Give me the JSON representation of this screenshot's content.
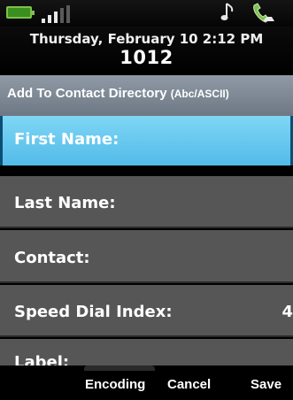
{
  "status": {
    "battery_icon": "battery-icon",
    "signal_icon": "signal-bars-icon",
    "music_icon": "music-note-icon",
    "handset_icon": "handset-icon"
  },
  "header": {
    "datetime": "Thursday, February 10 2:12 PM",
    "extension": "1012"
  },
  "title": {
    "text": "Add To Contact Directory",
    "mode": "(Abc/ASCII)"
  },
  "fields": [
    {
      "label": "First Name:",
      "value": ""
    },
    {
      "label": "Last Name:",
      "value": ""
    },
    {
      "label": "Contact:",
      "value": ""
    },
    {
      "label": "Speed Dial Index:",
      "value": "4"
    },
    {
      "label": "Label:",
      "value": ""
    }
  ],
  "softkeys": {
    "encoding": "Encoding",
    "cancel": "Cancel",
    "save": "Save"
  },
  "colors": {
    "selected_field": "#5cc4ee",
    "field_bg": "#565656",
    "titlebar": "#7b8692",
    "battery": "#3a8f1e"
  }
}
